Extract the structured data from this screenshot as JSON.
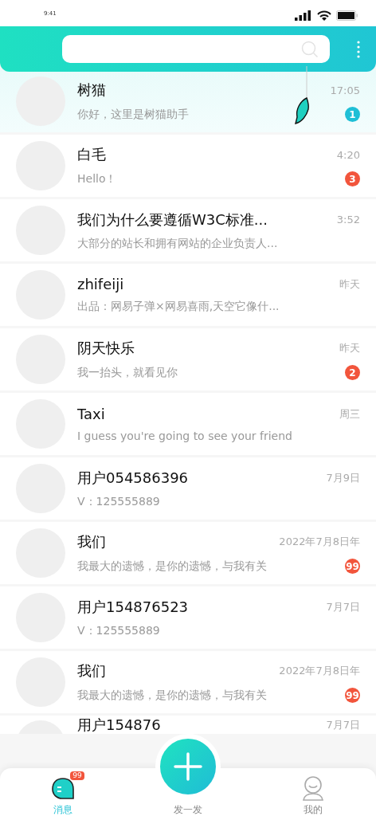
{
  "status_bar": {
    "time": "9:41"
  },
  "chats": [
    {
      "title": "树猫",
      "preview": "你好，这里是树猫助手",
      "time": "17:05",
      "selected": true,
      "badge": {
        "count": "1",
        "color": "#1fbfd6"
      }
    },
    {
      "title": "白毛",
      "preview": "Hello！",
      "time": "4:20",
      "selected": false,
      "badge": {
        "count": "3",
        "color": "#f2553c"
      }
    },
    {
      "title": "我们为什么要遵循W3C标准...",
      "preview": "大部分的站长和拥有网站的企业负责人...",
      "time": "3:52",
      "selected": false
    },
    {
      "title": "zhifeiji",
      "preview": "出品：网易子弹×网易喜雨,天空它像什...",
      "time": "昨天",
      "selected": false
    },
    {
      "title": "阴天快乐",
      "preview": "我一抬头，就看见你",
      "time": "昨天",
      "selected": false,
      "badge": {
        "count": "2",
        "color": "#f2553c"
      }
    },
    {
      "title": "Taxi",
      "preview": "I guess you're going to see your friend",
      "time": "周三",
      "selected": false
    },
    {
      "title": "用户054586396",
      "preview": "V：125555889",
      "time": "7月9日",
      "selected": false
    },
    {
      "title": "我们",
      "preview": "我最大的遗憾，是你的遗憾，与我有关",
      "time": "2022年7月8日年",
      "selected": false,
      "badge": {
        "count": "99",
        "color": "#f2553c"
      }
    },
    {
      "title": "用户154876523",
      "preview": "V：125555889",
      "time": "7月7日",
      "selected": false
    },
    {
      "title": "我们",
      "preview": "我最大的遗憾，是你的遗憾，与我有关",
      "time": "2022年7月8日年",
      "selected": false,
      "badge": {
        "count": "99",
        "color": "#f2553c"
      }
    },
    {
      "title": "用户154876",
      "time": "7月7日",
      "selected": false
    }
  ],
  "tab_bar": [
    {
      "kind": "messages",
      "label": "消息",
      "selected": true,
      "badge": "99"
    },
    {
      "kind": "compose",
      "label": "发一发",
      "selected": false
    },
    {
      "kind": "profile",
      "label": "我的",
      "selected": false
    }
  ]
}
